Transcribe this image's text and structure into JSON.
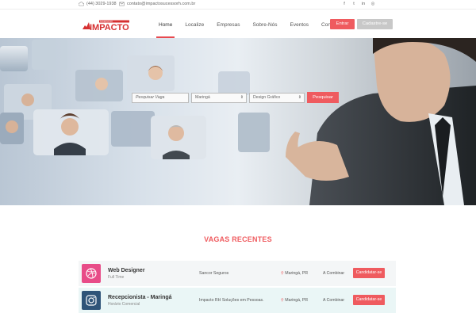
{
  "topbar": {
    "phone": "(44) 3029-1938",
    "email": "contato@impactosucessorh.com.br",
    "social_icons": [
      "facebook-icon",
      "twitter-icon",
      "linkedin-icon",
      "instagram-icon"
    ],
    "social_glyphs": [
      "f",
      "t",
      "in",
      "◎"
    ]
  },
  "header": {
    "logo_text": "IMPACTO",
    "logo_tagline": "SUCESSO RH",
    "nav": [
      "Home",
      "Localize",
      "Empresas",
      "Sobre-Nós",
      "Eventos",
      "Contato"
    ],
    "active_nav": "Home",
    "login_label": "Entrar",
    "register_label": "Cadastre-se"
  },
  "search": {
    "placeholder": "Pesquisar Vaga",
    "city": "Maringá",
    "category": "Design Gráfico",
    "button_label": "Pesquisar"
  },
  "jobs": {
    "section_title": "VAGAS RECENTES",
    "items": [
      {
        "title": "Web Designer",
        "type": "Full Time",
        "company": "Sancor Seguros",
        "location": "Maringá, PR",
        "salary": "A Combinar",
        "apply_label": "Candidatar-se",
        "icon": "dribbble-icon",
        "icon_color": "#e84c88"
      },
      {
        "title": "Recepcionista - Maringá",
        "type": "Horário Comercial",
        "company": "Impacto RH Soluções em Pessoas.",
        "location": "Maringá, PR",
        "salary": "A Combinar",
        "apply_label": "Candidatar-se",
        "icon": "instagram-icon",
        "icon_color": "#2f5478"
      }
    ]
  },
  "colors": {
    "accent": "#ef5b5f",
    "secondary_button": "#c8c8c8"
  }
}
